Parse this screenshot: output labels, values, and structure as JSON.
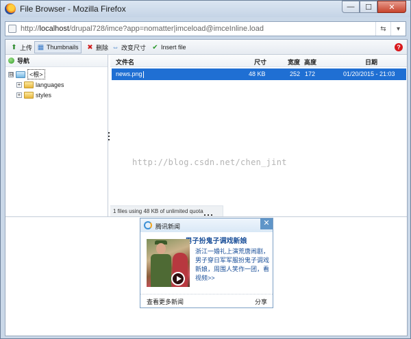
{
  "window": {
    "title": "File Browser - Mozilla Firefox",
    "controls": {
      "minimize": "—",
      "maximize": "☐",
      "close": "✕"
    }
  },
  "address_bar": {
    "url_prefix": "http://",
    "url_host": "localhost",
    "url_rest": "/drupal728/imce?app=nomatter|imceload@imceInline.load"
  },
  "toolbar": {
    "upload": "上传",
    "thumbnails": "Thumbnails",
    "delete": "删除",
    "resize": "改变尺寸",
    "insert": "Insert file",
    "help": "?"
  },
  "navigation": {
    "heading": "导航",
    "tree": [
      {
        "label": "<根>",
        "toggle": "⊟",
        "root": true
      },
      {
        "label": "languages",
        "toggle": "+",
        "root": false
      },
      {
        "label": "styles",
        "toggle": "+",
        "root": false
      }
    ]
  },
  "file_list": {
    "columns": {
      "name": "文件名",
      "size": "尺寸",
      "width": "宽度",
      "height": "高度",
      "date": "日期"
    },
    "rows": [
      {
        "name": "news.png",
        "size": "48 KB",
        "width": "252",
        "height": "172",
        "date": "01/20/2015 - 21:03"
      }
    ],
    "status": "1 files using 48 KB of unlimited quota"
  },
  "watermark": "http://blog.csdn.net/chen_jint",
  "popup": {
    "source": "腾讯新闻",
    "close": "✕",
    "headline": "男子扮鬼子调戏新娘",
    "summary": "浙江一婚礼上演荒唐闹剧，男子穿日军军服扮鬼子调戏新娘，周围人笑作一团，看视频>>",
    "more": "查看更多新闻",
    "share": "分享"
  },
  "colors": {
    "selection": "#1f6fd3",
    "window_frame": "#cad8e8",
    "help_red": "#d8181c"
  }
}
